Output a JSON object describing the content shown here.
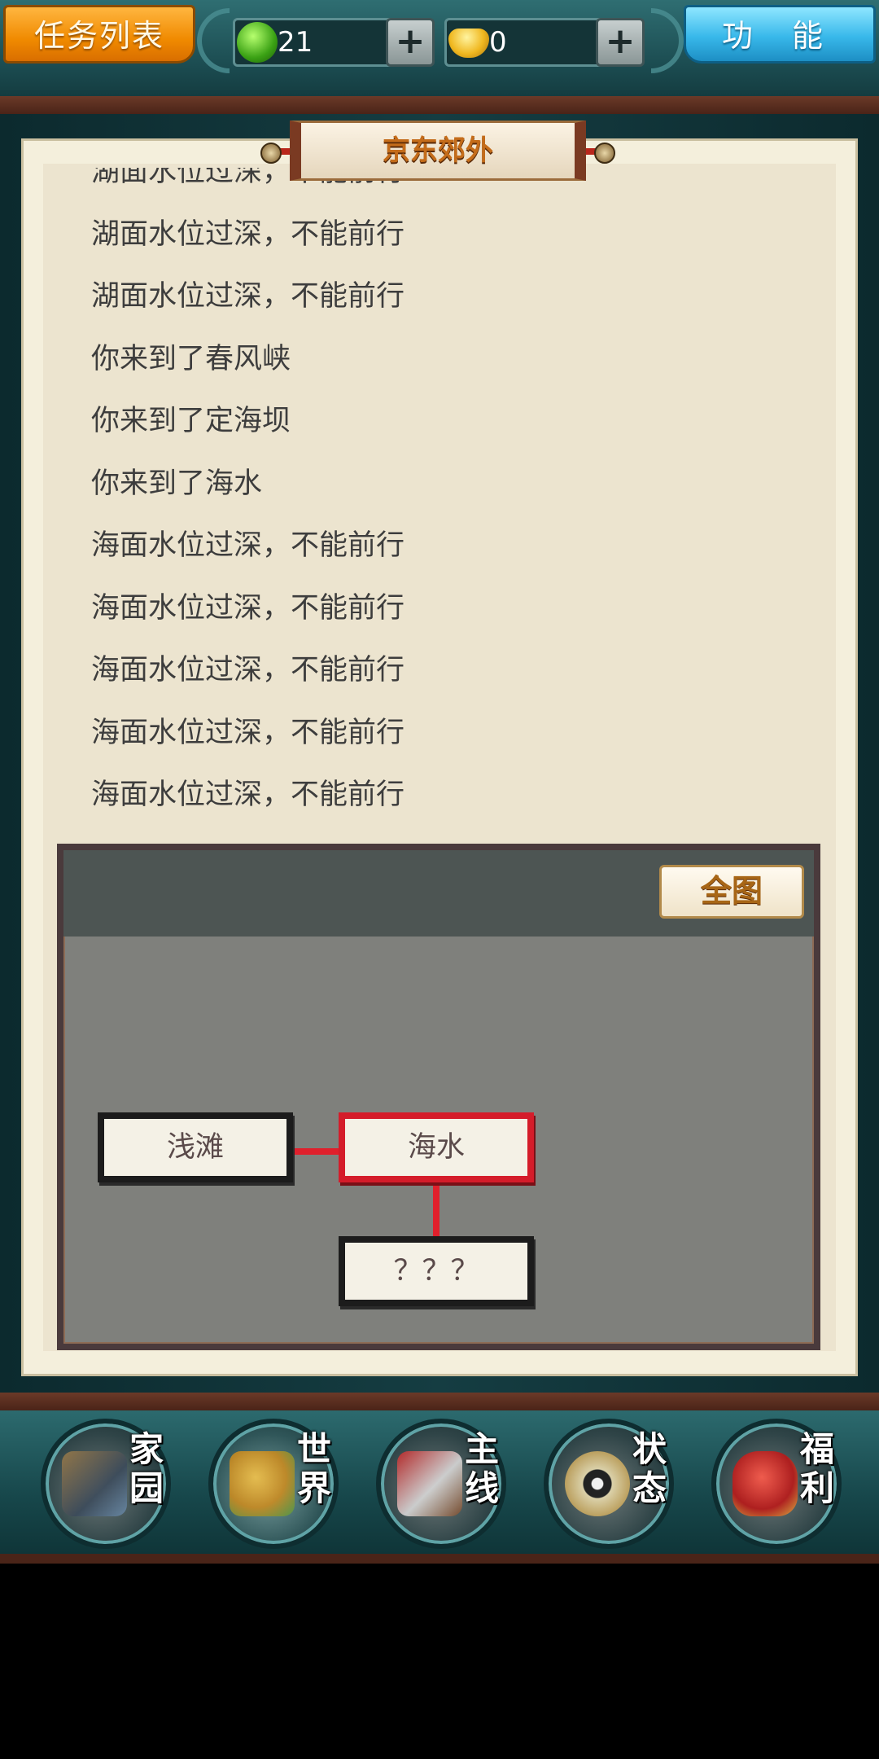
{
  "topbar": {
    "tasks_label": "任务列表",
    "function_label": "功 能",
    "jade_value": "21",
    "gold_value": "0",
    "plus_label": "+",
    "jade_icon": "jade-coin-icon",
    "gold_icon": "gold-ingot-icon"
  },
  "location": {
    "title": "京东郊外"
  },
  "log": [
    "湖面水位过深，不能前行",
    "湖面水位过深，不能前行",
    "湖面水位过深，不能前行",
    "你来到了春风峡",
    "你来到了定海坝",
    "你来到了海水",
    "海面水位过深，不能前行",
    "海面水位过深，不能前行",
    "海面水位过深，不能前行",
    "海面水位过深，不能前行",
    "海面水位过深，不能前行"
  ],
  "map": {
    "full_map_label": "全图",
    "nodes": {
      "west": "浅滩",
      "current": "海水",
      "south": "？？？"
    }
  },
  "nav": [
    {
      "label": "家园",
      "icon": "home-icon"
    },
    {
      "label": "世界",
      "icon": "world-icon"
    },
    {
      "label": "主线",
      "icon": "main-quest-icon"
    },
    {
      "label": "状态",
      "icon": "status-icon"
    },
    {
      "label": "福利",
      "icon": "welfare-icon"
    }
  ],
  "colors": {
    "accent_orange": "#f08a00",
    "accent_blue": "#38b8ea",
    "current_node_red": "#d41c2a",
    "panel_bg": "#ece4cf"
  }
}
